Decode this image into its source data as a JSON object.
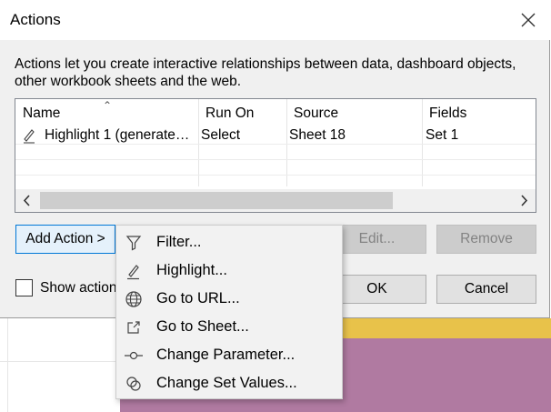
{
  "dialog": {
    "title": "Actions",
    "description": "Actions let you create interactive relationships between data, dashboard objects, other workbook sheets and the web."
  },
  "table": {
    "columns": [
      "Name",
      "Run On",
      "Source",
      "Fields"
    ],
    "rows": [
      {
        "name": "Highlight 1 (generate…",
        "run_on": "Select",
        "source": "Sheet 18",
        "fields": "Set 1"
      }
    ]
  },
  "buttons": {
    "add_action": "Add Action >",
    "edit": "Edit...",
    "remove": "Remove",
    "ok": "OK",
    "cancel": "Cancel"
  },
  "checkbox": {
    "label": "Show action",
    "checked": false
  },
  "menu": {
    "items": [
      {
        "label": "Filter...",
        "icon": "filter-icon"
      },
      {
        "label": "Highlight...",
        "icon": "highlight-pen-icon"
      },
      {
        "label": "Go to URL...",
        "icon": "globe-icon"
      },
      {
        "label": "Go to Sheet...",
        "icon": "external-link-icon"
      },
      {
        "label": "Change Parameter...",
        "icon": "parameter-slider-icon"
      },
      {
        "label": "Change Set Values...",
        "icon": "set-values-icon"
      }
    ]
  },
  "colors": {
    "background_yellow": "#e8c24a",
    "background_purple": "#b07aa1",
    "focus_blue": "#0078d7"
  }
}
